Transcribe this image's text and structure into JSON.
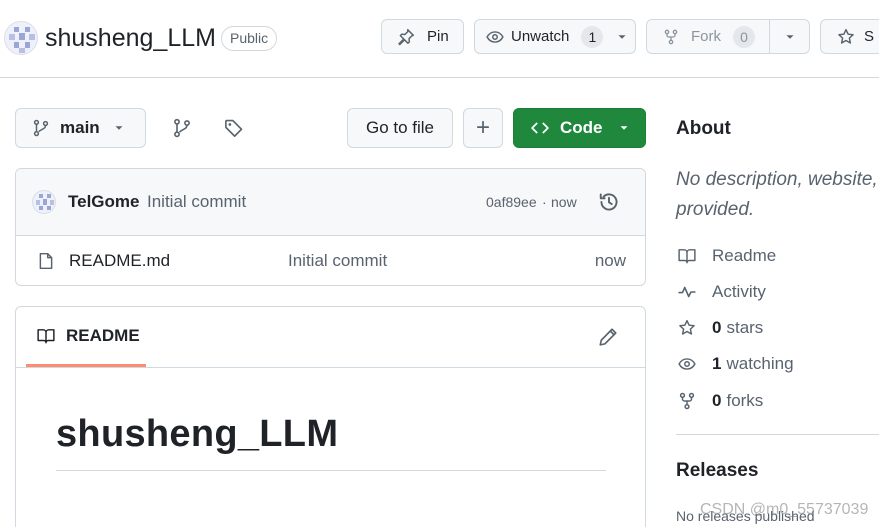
{
  "repo": {
    "name": "shusheng_LLM",
    "visibility": "Public"
  },
  "actions": {
    "pin_label": "Pin",
    "unwatch_label": "Unwatch",
    "watch_count": "1",
    "fork_label": "Fork",
    "fork_count": "0",
    "star_label": "S"
  },
  "toolbar": {
    "branch": "main",
    "go_to_file": "Go to file",
    "add": "+",
    "code": "Code"
  },
  "commit": {
    "author": "TelGome",
    "message": "Initial commit",
    "hash": "0af89ee",
    "separator": "·",
    "time": "now"
  },
  "files": [
    {
      "name": "README.md",
      "message": "Initial commit",
      "time": "now"
    }
  ],
  "readme": {
    "tab_label": "README",
    "heading": "shusheng_LLM"
  },
  "about": {
    "title": "About",
    "description": "No description, website, provided.",
    "readme": "Readme",
    "activity": "Activity",
    "stars_count": "0",
    "stars_label": "stars",
    "watching_count": "1",
    "watching_label": "watching",
    "forks_count": "0",
    "forks_label": "forks"
  },
  "releases": {
    "title": "Releases",
    "empty": "No releases published"
  },
  "watermark": "CSDN @m0_55737039",
  "colors": {
    "code_button": "#1f883d",
    "readme_tab_underline": "#fd8c73",
    "border": "#d1d9e0",
    "muted_text": "#59636e"
  }
}
